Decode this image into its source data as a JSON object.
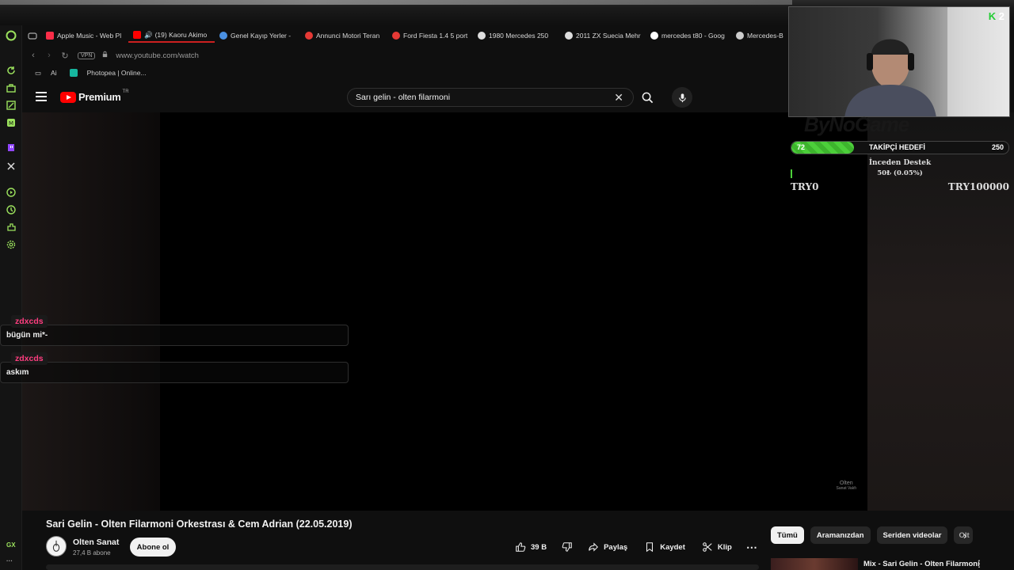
{
  "browser": {
    "tabs": [
      {
        "label": "Apple Music - Web Pl",
        "color": "#fa2d48"
      },
      {
        "label": "(19) Kaoru Akimo",
        "color": "#ff0000",
        "active": true
      },
      {
        "label": "Genel Kayıp Yerler - ",
        "color": "#4a90e2"
      },
      {
        "label": "Annunci Motori Teran",
        "color": "#e53935"
      },
      {
        "label": "Ford Fiesta 1.4 5 port",
        "color": "#e53935"
      },
      {
        "label": "1980 Mercedes 250 ",
        "color": "#dddddd"
      },
      {
        "label": "2011 ZX Suecia Mehr",
        "color": "#dddddd"
      },
      {
        "label": "mercedes t80 - Goog",
        "color": "#ffffff"
      },
      {
        "label": "Mercedes-B",
        "color": "#cccccc"
      }
    ],
    "vpn_label": "VPN",
    "url": "www.youtube.com/watch",
    "bookmarks": [
      "Ai",
      "Photopea | Online..."
    ],
    "sidebar_bottom_label": "GX"
  },
  "youtube": {
    "logo_text": "Premium",
    "country_code": "TR",
    "search_value": "Sarı gelin - olten filarmoni"
  },
  "chat": [
    {
      "user": "zdxcds",
      "message": "bügün mi*-"
    },
    {
      "user": "zdxcds",
      "message": "askım"
    }
  ],
  "stream_overlay": {
    "cam_badge_letter": "K",
    "cam_badge_number": "2",
    "brand_text": "ByNoGame",
    "goal_current": "72",
    "goal_label": "TAKİPÇİ HEDEFİ",
    "goal_max": "250",
    "goal_fraction": 0.288,
    "donation_title": "İnceden Destek",
    "donation_value": "50₺ (0.05%)",
    "donation_min": "TRY0",
    "donation_max": "TRY100000"
  },
  "video": {
    "watermark_line1": "Olten",
    "watermark_line2": "Sanat Vakfı",
    "title": "Sari Gelin - Olten Filarmoni Orkestrası & Cem Adrian (22.05.2019)",
    "channel_name": "Olten Sanat",
    "channel_subs": "27,4 B abone",
    "subscribe_label": "Abone ol",
    "like_count": "39 B",
    "share_label": "Paylaş",
    "save_label": "Kaydet",
    "clip_label": "Klip"
  },
  "related": {
    "chips": [
      "Tümü",
      "Aramanızdan",
      "Seriden videolar",
      "Olt"
    ],
    "mix_title": "Mix - Sari Gelin - Olten Filarmoni"
  }
}
